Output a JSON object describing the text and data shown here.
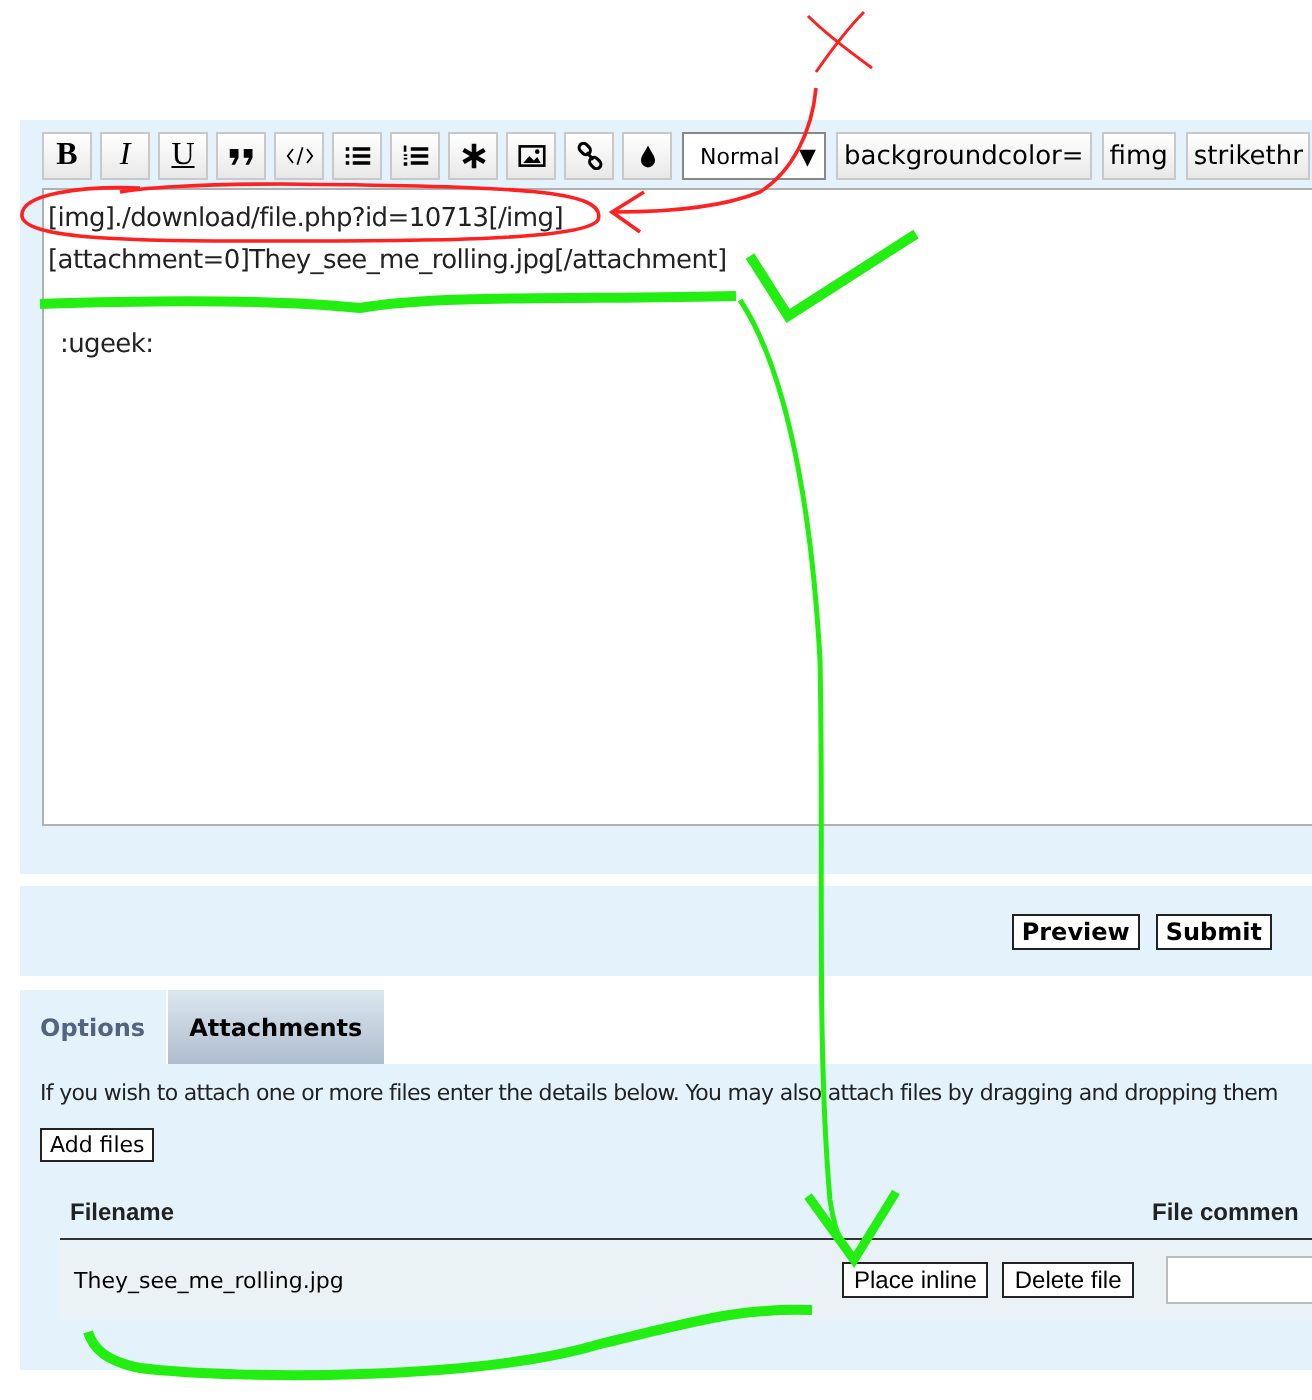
{
  "toolbar": {
    "buttons": [
      {
        "kind": "text",
        "label": "B"
      },
      {
        "kind": "text",
        "label": "I"
      },
      {
        "kind": "text",
        "label": "U"
      },
      {
        "kind": "icon"
      },
      {
        "kind": "icon"
      },
      {
        "kind": "icon"
      },
      {
        "kind": "icon"
      },
      {
        "kind": "icon"
      },
      {
        "kind": "icon"
      },
      {
        "kind": "icon"
      },
      {
        "kind": "icon"
      }
    ],
    "size_select": {
      "value": "Normal",
      "arrow": "▼"
    },
    "extra_buttons": [
      "backgroundcolor=",
      "fimg",
      "strikethr"
    ]
  },
  "editor": {
    "paragraphs": [
      [
        "[img]./download/file.php?id=10713[/img]",
        "[attachment=0]They_see_me_rolling.jpg[/attachment]"
      ],
      [
        ":ugeek:"
      ]
    ]
  },
  "actions": [
    "Preview",
    "Submit"
  ],
  "tabs": [
    {
      "label": "Options",
      "selected": false
    },
    {
      "label": "Attachments",
      "selected": true
    }
  ],
  "attachments": {
    "intro": "If you wish to attach one or more files enter the details below. You may also attach files by dragging and dropping them",
    "add_button": "Add files",
    "columns": [
      "Filename",
      "File commen"
    ],
    "rows": [
      {
        "filename": "They_see_me_rolling.jpg",
        "buttons": [
          "Place inline",
          "Delete file"
        ]
      }
    ]
  },
  "annotations": [
    {
      "kind": "cross"
    },
    {
      "kind": "arrow"
    },
    {
      "kind": "ellipse"
    },
    {
      "kind": "underline"
    },
    {
      "kind": "checkmark"
    },
    {
      "kind": "arrow"
    },
    {
      "kind": "underline"
    }
  ]
}
